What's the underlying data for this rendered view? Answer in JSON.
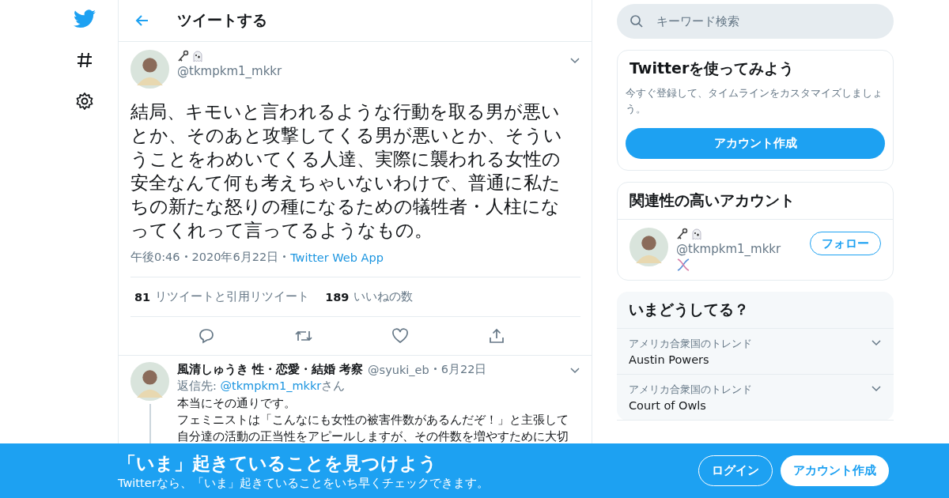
{
  "header": {
    "title": "ツイートする"
  },
  "tweet": {
    "handle": "@tkmpkm1_mkkr",
    "text": "結局、キモいと言われるような行動を取る男が悪いとか、そのあと攻撃してくる男が悪いとか、そういうことをわめいてくる人達、実際に襲われる女性の安全なんて何も考えちゃいないわけで、普通に私たちの新たな怒りの種になるための犠牲者・人柱になってくれって言ってるようなもの。",
    "time": "午後0:46",
    "date": "2020年6月22日",
    "source": "Twitter Web App",
    "retweets": "81",
    "retweets_label": "リツイートと引用リツイート",
    "likes": "189",
    "likes_label": "いいねの数"
  },
  "reply": {
    "name": "風清しゅうき 性・恋愛・結婚 考察",
    "handle": "@syuki_eb",
    "date": "6月22日",
    "reply_to_label": "返信先:",
    "reply_to": "@tkmpkm1_mkkr",
    "reply_to_suffix": "さん",
    "lines": [
      "本当にその通りです。",
      "フェミニストは「こんなにも女性の被害件数があるんだぞ！」と主張して",
      "自分達の活動の正当性をアピールしますが、その件数を増やすために大切"
    ]
  },
  "search": {
    "placeholder": "キーワード検索"
  },
  "signup_card": {
    "title": "Twitterを使ってみよう",
    "text": "今すぐ登録して、タイムラインをカスタマイズしましょう。",
    "button": "アカウント作成"
  },
  "related": {
    "title": "関連性の高いアカウント",
    "handle": "@tkmpkm1_mkkr",
    "button": "フォロー"
  },
  "trends": {
    "title": "いまどうしてる？",
    "items": [
      {
        "context": "アメリカ合衆国のトレンド",
        "name": "Austin Powers"
      },
      {
        "context": "アメリカ合衆国のトレンド",
        "name": "Court of Owls"
      }
    ]
  },
  "banner": {
    "title": "「いま」起きていることを見つけよう",
    "text": "Twitterなら、「いま」起きていることをいち早くチェックできます。",
    "login": "ログイン",
    "signup": "アカウント作成"
  }
}
